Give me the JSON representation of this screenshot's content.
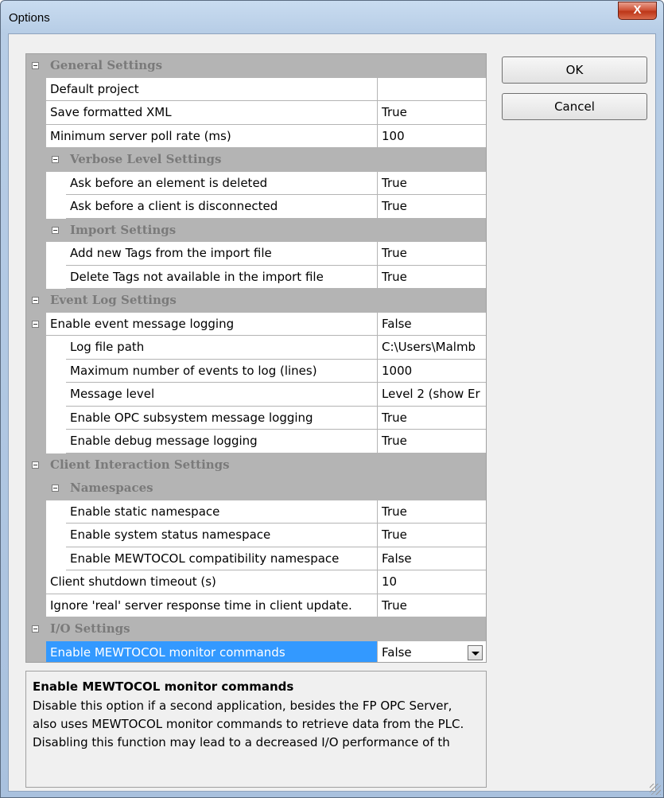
{
  "window": {
    "title": "Options",
    "close_label": "X"
  },
  "buttons": {
    "ok": "OK",
    "cancel": "Cancel"
  },
  "rows": [
    {
      "type": "cat",
      "level": 0,
      "name": "General Settings"
    },
    {
      "type": "item",
      "level": 0,
      "name": "Default project",
      "value": ""
    },
    {
      "type": "item",
      "level": 0,
      "name": "Save formatted XML",
      "value": "True"
    },
    {
      "type": "item",
      "level": 0,
      "name": "Minimum server poll rate (ms)",
      "value": "100"
    },
    {
      "type": "cat",
      "level": 1,
      "name": "Verbose Level Settings"
    },
    {
      "type": "item",
      "level": 1,
      "name": "Ask before an element is deleted",
      "value": "True"
    },
    {
      "type": "item",
      "level": 1,
      "name": "Ask before a client is disconnected",
      "value": "True"
    },
    {
      "type": "cat",
      "level": 1,
      "name": "Import Settings"
    },
    {
      "type": "item",
      "level": 1,
      "name": "Add new Tags from the import file",
      "value": "True"
    },
    {
      "type": "item",
      "level": 1,
      "name": "Delete Tags not available in the import file",
      "value": "True"
    },
    {
      "type": "cat",
      "level": 0,
      "name": "Event Log Settings"
    },
    {
      "type": "item",
      "level": 0,
      "name": "Enable event message logging",
      "value": "False",
      "expandable": true
    },
    {
      "type": "item",
      "level": 1,
      "name": "Log file path",
      "value": "C:\\Users\\Malmb"
    },
    {
      "type": "item",
      "level": 1,
      "name": "Maximum number of events to log (lines)",
      "value": "1000"
    },
    {
      "type": "item",
      "level": 1,
      "name": "Message level",
      "value": "Level 2 (show Er"
    },
    {
      "type": "item",
      "level": 1,
      "name": "Enable OPC subsystem message logging",
      "value": "True"
    },
    {
      "type": "item",
      "level": 1,
      "name": "Enable debug message logging",
      "value": "True"
    },
    {
      "type": "cat",
      "level": 0,
      "name": "Client Interaction Settings"
    },
    {
      "type": "cat",
      "level": 1,
      "name": "Namespaces"
    },
    {
      "type": "item",
      "level": 1,
      "name": "Enable static namespace",
      "value": "True"
    },
    {
      "type": "item",
      "level": 1,
      "name": "Enable system status namespace",
      "value": "True"
    },
    {
      "type": "item",
      "level": 1,
      "name": "Enable MEWTOCOL compatibility namespace",
      "value": "False"
    },
    {
      "type": "item",
      "level": 0,
      "name": "Client shutdown timeout (s)",
      "value": "10"
    },
    {
      "type": "item",
      "level": 0,
      "name": "Ignore 'real' server response time in client update.",
      "value": "True"
    },
    {
      "type": "cat",
      "level": 0,
      "name": "I/O Settings"
    },
    {
      "type": "item",
      "level": 0,
      "name": "Enable MEWTOCOL monitor commands",
      "value": "False",
      "selected": true
    }
  ],
  "help": {
    "title": "Enable MEWTOCOL monitor commands",
    "text": "Disable this option if a second application, besides the FP OPC Server, also uses MEWTOCOL monitor commands to retrieve data from the PLC.\nDisabling this function may lead to a decreased I/O performance of th"
  },
  "colors": {
    "category_bg": "#b4b4b4",
    "selection": "#3399ff"
  }
}
